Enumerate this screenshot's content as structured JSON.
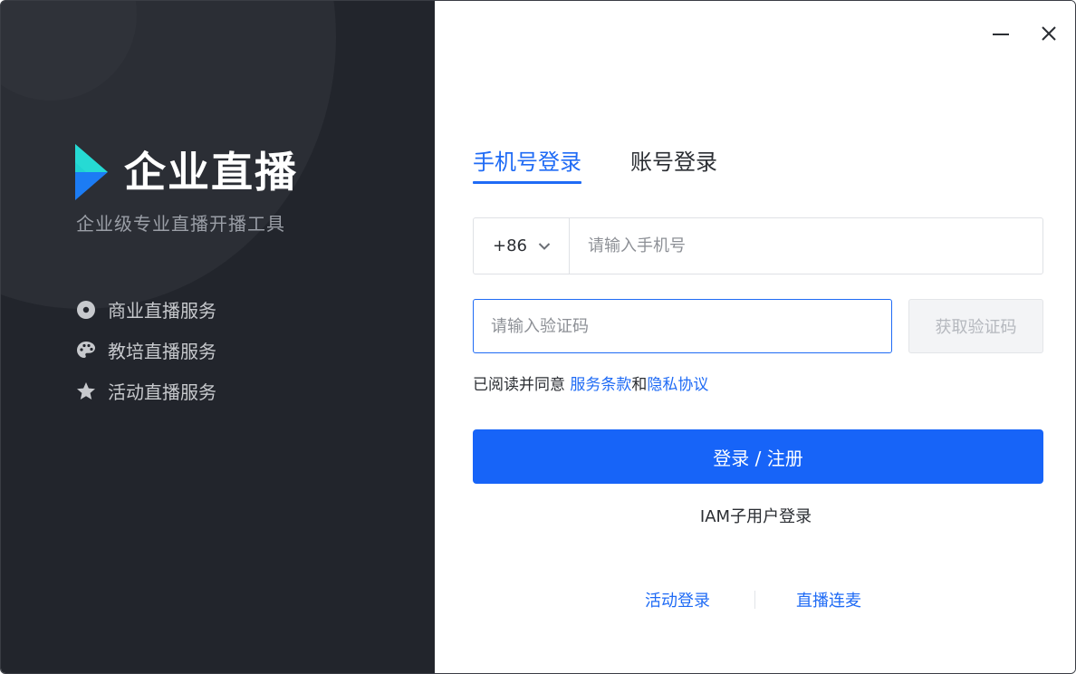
{
  "brand": {
    "title": "企业直播",
    "subtitle": "企业级专业直播开播工具",
    "logo_icon": "play-triangle-logo-icon",
    "colors": {
      "top": "#1fd3d1",
      "bottom": "#1c7cf4"
    }
  },
  "features": [
    {
      "label": "商业直播服务",
      "icon": "disc-icon"
    },
    {
      "label": "教培直播服务",
      "icon": "palette-icon"
    },
    {
      "label": "活动直播服务",
      "icon": "star-icon"
    }
  ],
  "window": {
    "minimize_icon": "minimize-icon",
    "close_icon": "close-icon"
  },
  "tabs": [
    {
      "label": "手机号登录",
      "active": true
    },
    {
      "label": "账号登录",
      "active": false
    }
  ],
  "phone": {
    "country_code": "+86",
    "country_icon": "chevron-down-icon",
    "placeholder": "请输入手机号",
    "value": ""
  },
  "code": {
    "placeholder": "请输入验证码",
    "value": "",
    "get_code_label": "获取验证码"
  },
  "agreement": {
    "prefix": "已阅读并同意",
    "terms": "服务条款",
    "joiner": "和",
    "privacy": "隐私协议"
  },
  "submit_label": "登录 / 注册",
  "iam_label": "IAM子用户登录",
  "bottom_links": [
    "活动登录",
    "直播连麦"
  ],
  "colors": {
    "accent": "#1f6bf5",
    "button": "#1764f8",
    "left_bg": "#22252c"
  }
}
